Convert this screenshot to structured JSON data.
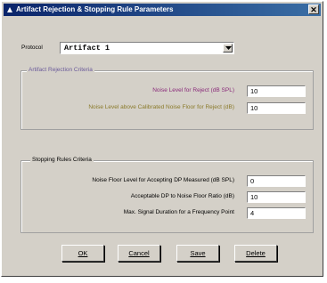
{
  "window": {
    "title": "Artifact Rejection & Stopping Rule Parameters",
    "close_glyph": "✕"
  },
  "protocol": {
    "label": "Protocol",
    "value": "Artifact 1"
  },
  "artifact_group": {
    "legend": "Artifact Rejection Criteria",
    "rows": [
      {
        "label": "Noise Level for Reject (dB SPL)",
        "value": "10",
        "color": "#8a2a7a"
      },
      {
        "label": "Noise Level above Calibrated Noise Floor for Reject (dB)",
        "value": "10",
        "color": "#8a7a2a"
      }
    ]
  },
  "stopping_group": {
    "legend": "Stopping Rules Criteria",
    "rows": [
      {
        "label": "Noise Floor Level for Accepting DP Measured (dB SPL)",
        "value": "0"
      },
      {
        "label": "Acceptable DP to Noise Floor Ratio (dB)",
        "value": "10"
      },
      {
        "label": "Max. Signal Duration for a Frequency Point",
        "value": "4"
      }
    ]
  },
  "buttons": {
    "ok": "OK",
    "cancel": "Cancel",
    "save": "Save",
    "delete": "Delete"
  },
  "colors": {
    "window_bg": "#d4d0c8",
    "legend_color": "#6a5a9a",
    "titlebar": "#0a246a"
  }
}
